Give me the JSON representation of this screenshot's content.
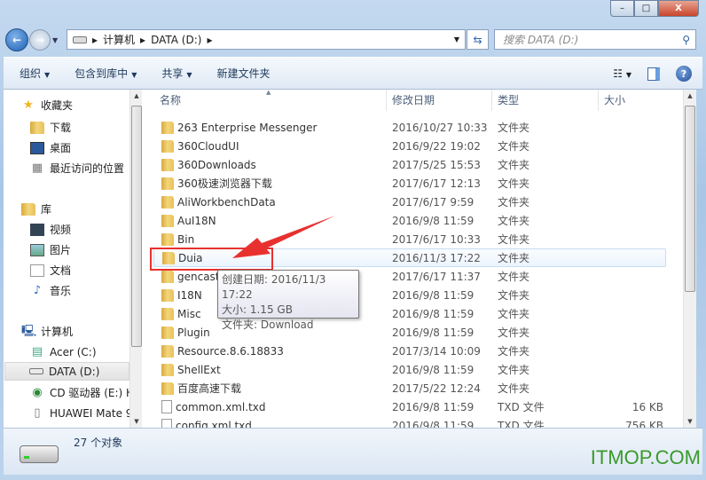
{
  "window": {
    "minimize": "–",
    "maximize": "□",
    "close": "X"
  },
  "address": {
    "segments": [
      "计算机",
      "DATA (D:)"
    ]
  },
  "search": {
    "placeholder": "搜索 DATA (D:)"
  },
  "toolbar": {
    "organize": "组织",
    "include_library": "包含到库中",
    "share": "共享",
    "new_folder": "新建文件夹"
  },
  "nav": {
    "favorites": "收藏夹",
    "fav_items": [
      "下载",
      "桌面",
      "最近访问的位置"
    ],
    "libraries": "库",
    "lib_items": [
      "视频",
      "图片",
      "文档",
      "音乐"
    ],
    "computer": "计算机",
    "comp_items": [
      "Acer (C:)",
      "DATA (D:)",
      "CD 驱动器 (E:) H",
      "HUAWEI Mate 9"
    ]
  },
  "columns": {
    "name": "名称",
    "date": "修改日期",
    "type": "类型",
    "size": "大小"
  },
  "files": [
    {
      "name": "263 Enterprise Messenger",
      "date": "2016/10/27 10:33",
      "type": "文件夹",
      "size": "",
      "kind": "folder"
    },
    {
      "name": "360CloudUI",
      "date": "2016/9/22 19:02",
      "type": "文件夹",
      "size": "",
      "kind": "folder"
    },
    {
      "name": "360Downloads",
      "date": "2017/5/25 15:53",
      "type": "文件夹",
      "size": "",
      "kind": "folder"
    },
    {
      "name": "360极速浏览器下载",
      "date": "2017/6/17 12:13",
      "type": "文件夹",
      "size": "",
      "kind": "folder"
    },
    {
      "name": "AliWorkbenchData",
      "date": "2017/6/17 9:59",
      "type": "文件夹",
      "size": "",
      "kind": "folder"
    },
    {
      "name": "AuI18N",
      "date": "2016/9/8 11:59",
      "type": "文件夹",
      "size": "",
      "kind": "folder"
    },
    {
      "name": "Bin",
      "date": "2017/6/17 10:33",
      "type": "文件夹",
      "size": "",
      "kind": "folder"
    },
    {
      "name": "Duia",
      "date": "2016/11/3 17:22",
      "type": "文件夹",
      "size": "",
      "kind": "folder"
    },
    {
      "name": "gencast",
      "date": "2017/6/17 11:37",
      "type": "文件夹",
      "size": "",
      "kind": "folder"
    },
    {
      "name": "I18N",
      "date": "2016/9/8 11:59",
      "type": "文件夹",
      "size": "",
      "kind": "folder"
    },
    {
      "name": "Misc",
      "date": "2016/9/8 11:59",
      "type": "文件夹",
      "size": "",
      "kind": "folder"
    },
    {
      "name": "Plugin",
      "date": "2016/9/8 11:59",
      "type": "文件夹",
      "size": "",
      "kind": "folder"
    },
    {
      "name": "Resource.8.6.18833",
      "date": "2017/3/14 10:09",
      "type": "文件夹",
      "size": "",
      "kind": "folder"
    },
    {
      "name": "ShellExt",
      "date": "2016/9/8 11:59",
      "type": "文件夹",
      "size": "",
      "kind": "folder"
    },
    {
      "name": "百度高速下载",
      "date": "2017/5/22 12:24",
      "type": "文件夹",
      "size": "",
      "kind": "folder"
    },
    {
      "name": "common.xml.txd",
      "date": "2016/9/8 11:59",
      "type": "TXD 文件",
      "size": "16 KB",
      "kind": "file"
    },
    {
      "name": "config.xml.txd",
      "date": "2016/9/8 11:59",
      "type": "TXD 文件",
      "size": "756 KB",
      "kind": "file"
    }
  ],
  "tooltip": {
    "created": "创建日期: 2016/11/3 17:22",
    "size": "大小: 1.15 GB",
    "folders": "文件夹: Download"
  },
  "status": {
    "count": "27 个对象"
  },
  "watermark": "ITMOP.COM",
  "colors": {
    "annotation": "#e8312f",
    "watermark": "#3a9a2a"
  }
}
